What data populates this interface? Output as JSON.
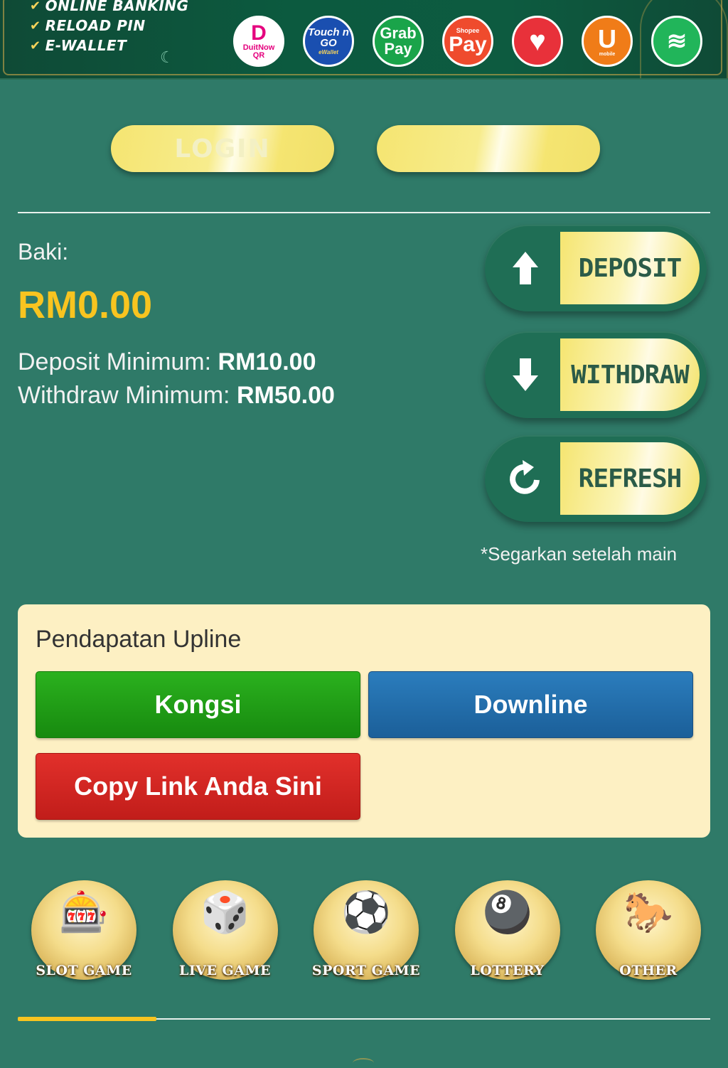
{
  "banner": {
    "features": [
      "ONLINE BANKING",
      "RELOAD PIN",
      "E-WALLET"
    ],
    "payment_methods": [
      {
        "name": "DuitNow QR",
        "text": "DuitNow",
        "sub": "QR"
      },
      {
        "name": "Touch n Go",
        "text": "Touch n GO",
        "sub": "eWallet"
      },
      {
        "name": "GrabPay",
        "text": "Grab Pay"
      },
      {
        "name": "ShopeePay",
        "text": "Pay",
        "sub": "Shopee"
      },
      {
        "name": "Boost",
        "text": "♥"
      },
      {
        "name": "U Mobile",
        "text": "U",
        "sub": "mobile"
      },
      {
        "name": "Maxis",
        "text": "≋"
      }
    ]
  },
  "auth": {
    "login_label": "LOGIN",
    "register_label": ""
  },
  "balance": {
    "label": "Baki:",
    "value": "RM0.00",
    "deposit_min_label": "Deposit Minimum:",
    "deposit_min_value": "RM10.00",
    "withdraw_min_label": "Withdraw Minimum:",
    "withdraw_min_value": "RM50.00"
  },
  "actions": {
    "deposit": "DEPOSIT",
    "withdraw": "WITHDRAW",
    "refresh": "REFRESH",
    "refresh_hint": "*Segarkan setelah main"
  },
  "upline": {
    "title": "Pendapatan Upline",
    "share_label": "Kongsi",
    "downline_label": "Downline",
    "copy_link_label": "Copy Link Anda Sini"
  },
  "games": [
    {
      "label": "SLOT GAME",
      "icon": "slot-machine-icon"
    },
    {
      "label": "LIVE GAME",
      "icon": "roulette-icon"
    },
    {
      "label": "SPORT GAME",
      "icon": "soccer-icon"
    },
    {
      "label": "LOTTERY",
      "icon": "lottery-balls-icon"
    },
    {
      "label": "OTHER",
      "icon": "horse-racing-icon"
    }
  ],
  "games_scroll_progress": 0.2,
  "colors": {
    "background": "#2f7a68",
    "accent_gold": "#f8c420",
    "card_bg": "#fdf0c3",
    "btn_green": "#1f9a15",
    "btn_blue": "#236fab",
    "btn_red": "#d2261f"
  }
}
